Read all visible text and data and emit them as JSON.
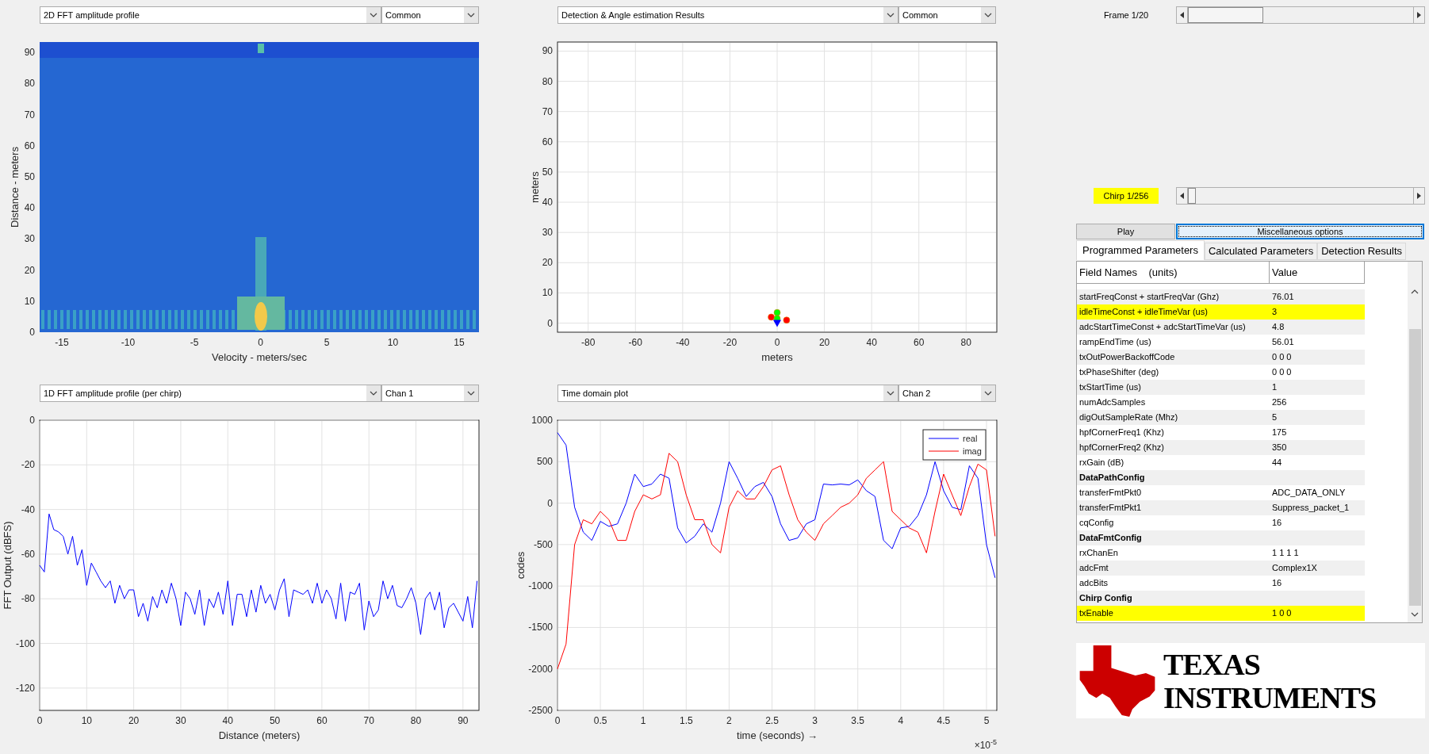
{
  "plots": [
    {
      "kind": "heatmap",
      "selector": "2D FFT amplitude profile",
      "option": "Common",
      "xticks": [
        "-15",
        "-10",
        "-5",
        "0",
        "5",
        "10",
        "15"
      ],
      "yticks": [
        "90",
        "80",
        "70",
        "60",
        "50",
        "40",
        "30",
        "20",
        "10",
        "0"
      ],
      "xlabel": "Velocity - meters/sec",
      "ylabel": "Distance - meters"
    },
    {
      "kind": "chart",
      "selector": "Detection & Angle estimation Results",
      "option": "Common",
      "chart_data": {
        "type": "scatter",
        "xlabel": "meters",
        "ylabel": "meters",
        "x": [
          -2.5,
          0,
          0,
          4,
          0
        ],
        "series": [
          {
            "color": "#ff0000",
            "marker": "circle",
            "values": [
              2,
              null,
              null,
              1,
              null
            ]
          },
          {
            "color": "#00ff00",
            "marker": "circle",
            "values": [
              null,
              3.5,
              1.5,
              null,
              null
            ]
          },
          {
            "color": "#0000ff",
            "marker": "triangle",
            "values": [
              null,
              null,
              null,
              null,
              0
            ]
          }
        ],
        "xlim": [
          -93,
          93
        ],
        "ylim": [
          -3,
          93
        ],
        "grid": true,
        "xticks": [
          -80,
          -60,
          -40,
          -20,
          0,
          20,
          40,
          60,
          80
        ],
        "yticks": [
          0,
          10,
          20,
          30,
          40,
          50,
          60,
          70,
          80,
          90
        ]
      }
    },
    {
      "kind": "chart",
      "selector": "1D FFT amplitude profile (per chirp)",
      "option": "Chan 1",
      "chart_data": {
        "type": "line",
        "xlabel": "Distance (meters)",
        "ylabel": "FFT Output (dBFS)",
        "x": [
          0,
          1,
          2,
          3,
          4,
          5,
          6,
          7,
          8,
          9,
          10,
          11,
          12,
          13,
          14,
          15,
          16,
          17,
          18,
          19,
          20,
          21,
          22,
          23,
          24,
          25,
          26,
          27,
          28,
          29,
          30,
          31,
          32,
          33,
          34,
          35,
          36,
          37,
          38,
          39,
          40,
          41,
          42,
          43,
          44,
          45,
          46,
          47,
          48,
          49,
          50,
          51,
          52,
          53,
          54,
          55,
          56,
          57,
          58,
          59,
          60,
          61,
          62,
          63,
          64,
          65,
          66,
          67,
          68,
          69,
          70,
          71,
          72,
          73,
          74,
          75,
          76,
          77,
          78,
          79,
          80,
          81,
          82,
          83,
          84,
          85,
          86,
          87,
          88,
          89,
          90,
          91,
          92,
          93
        ],
        "series": [
          {
            "color": "#0000ff",
            "values": [
              -65,
              -68,
              -42,
              -49,
              -50,
              -52,
              -60,
              -52,
              -65,
              -58,
              -74,
              -64,
              -68,
              -72,
              -75,
              -72,
              -82,
              -74,
              -80,
              -76,
              -76,
              -88,
              -82,
              -90,
              -79,
              -84,
              -76,
              -82,
              -73,
              -80,
              -92,
              -77,
              -80,
              -87,
              -76,
              -92,
              -80,
              -84,
              -77,
              -87,
              -72,
              -92,
              -78,
              -78,
              -88,
              -76,
              -86,
              -74,
              -82,
              -78,
              -85,
              -76,
              -71,
              -88,
              -76,
              -77,
              -78,
              -76,
              -82,
              -73,
              -82,
              -76,
              -80,
              -89,
              -73,
              -90,
              -77,
              -78,
              -73,
              -94,
              -81,
              -88,
              -85,
              -72,
              -80,
              -74,
              -83,
              -84,
              -80,
              -75,
              -82,
              -96,
              -80,
              -77,
              -85,
              -77,
              -93,
              -84,
              -82,
              -86,
              -90,
              -79,
              -93,
              -72
            ]
          }
        ],
        "xlim": [
          0,
          93.4
        ],
        "ylim": [
          -130,
          0
        ],
        "grid": true,
        "xticks": [
          0,
          10,
          20,
          30,
          40,
          50,
          60,
          70,
          80,
          90
        ],
        "yticks": [
          -120,
          -100,
          -80,
          -60,
          -40,
          -20,
          0
        ]
      }
    },
    {
      "kind": "chart",
      "selector": "Time domain plot",
      "option": "Chan 2",
      "axis_multiplier": {
        "base": "×10",
        "exponent": "-5"
      },
      "chart_data": {
        "type": "line",
        "xlabel": "time  (seconds) →",
        "ylabel": "codes",
        "x": [
          0,
          0.1,
          0.2,
          0.3,
          0.4,
          0.5,
          0.6,
          0.7,
          0.8,
          0.9,
          1,
          1.1,
          1.2,
          1.3,
          1.4,
          1.5,
          1.6,
          1.7,
          1.8,
          1.9,
          2,
          2.1,
          2.2,
          2.3,
          2.4,
          2.5,
          2.6,
          2.7,
          2.8,
          2.9,
          3,
          3.1,
          3.2,
          3.3,
          3.4,
          3.5,
          3.6,
          3.7,
          3.8,
          3.9,
          4,
          4.1,
          4.2,
          4.3,
          4.4,
          4.5,
          4.6,
          4.7,
          4.8,
          4.9,
          5,
          5.1
        ],
        "series": [
          {
            "name": "real",
            "color": "#0000ff",
            "values": [
              850,
              700,
              -50,
              -350,
              -450,
              -220,
              -280,
              -250,
              0,
              350,
              200,
              230,
              350,
              300,
              -300,
              -480,
              -400,
              -250,
              -350,
              0,
              500,
              300,
              80,
              200,
              250,
              80,
              -250,
              -450,
              -420,
              -250,
              -200,
              230,
              220,
              230,
              220,
              280,
              150,
              80,
              -450,
              -550,
              -300,
              -280,
              -150,
              100,
              500,
              150,
              -50,
              -80,
              450,
              300,
              -500,
              -900
            ]
          },
          {
            "name": "imag",
            "color": "#ff0000",
            "values": [
              -2000,
              -1700,
              -500,
              -200,
              -250,
              -100,
              -200,
              -450,
              -450,
              -100,
              100,
              50,
              100,
              600,
              500,
              100,
              -200,
              -200,
              -500,
              -600,
              -50,
              150,
              50,
              50,
              200,
              400,
              450,
              100,
              -200,
              -350,
              -450,
              -250,
              -150,
              -50,
              0,
              100,
              300,
              400,
              500,
              -100,
              -200,
              -300,
              -350,
              -600,
              -100,
              350,
              100,
              -150,
              200,
              470,
              400,
              -400
            ]
          }
        ],
        "xlim": [
          0,
          5.12
        ],
        "ylim": [
          -2500,
          1000
        ],
        "grid": true,
        "legend": true,
        "xticks": [
          0,
          0.5,
          1,
          1.5,
          2,
          2.5,
          3,
          3.5,
          4,
          4.5,
          5
        ],
        "yticks": [
          -2500,
          -2000,
          -1500,
          -1000,
          -500,
          0,
          500,
          1000
        ]
      }
    }
  ],
  "sliders": [
    {
      "label": "Frame 1/20",
      "highlighted": false,
      "level": 0
    },
    {
      "label": "Chirp 1/256",
      "highlighted": true,
      "level": 0
    }
  ],
  "buttons": [
    {
      "label": "Play",
      "focused": false
    },
    {
      "label": "Miscellaneous options",
      "focused": true
    }
  ],
  "tabs": [
    {
      "label": "Programmed Parameters",
      "selected": true
    },
    {
      "label": "Calculated Parameters",
      "selected": false
    },
    {
      "label": "Detection Results",
      "selected": false
    }
  ],
  "table": {
    "columns": [
      "Field Names    (units)",
      "Value"
    ],
    "rows": [
      {
        "kind": "field",
        "name": "startFreqConst + startFreqVar (Ghz)",
        "value": "76.01",
        "highlighted": false
      },
      {
        "kind": "field",
        "name": "idleTimeConst + idleTimeVar (us)",
        "value": "3",
        "highlighted": true
      },
      {
        "kind": "field",
        "name": "adcStartTimeConst + adcStartTimeVar (us)",
        "value": "4.8",
        "highlighted": false
      },
      {
        "kind": "field",
        "name": "rampEndTime (us)",
        "value": "56.01",
        "highlighted": false
      },
      {
        "kind": "field",
        "name": "txOutPowerBackoffCode",
        "value": "0 0 0",
        "highlighted": false
      },
      {
        "kind": "field",
        "name": "txPhaseShifter (deg)",
        "value": "0 0 0",
        "highlighted": false
      },
      {
        "kind": "field",
        "name": "txStartTime (us)",
        "value": "1",
        "highlighted": false
      },
      {
        "kind": "field",
        "name": "numAdcSamples",
        "value": "256",
        "highlighted": false
      },
      {
        "kind": "field",
        "name": "digOutSampleRate (Mhz)",
        "value": "5",
        "highlighted": false
      },
      {
        "kind": "field",
        "name": "hpfCornerFreq1 (Khz)",
        "value": "175",
        "highlighted": false
      },
      {
        "kind": "field",
        "name": "hpfCornerFreq2 (Khz)",
        "value": "350",
        "highlighted": false
      },
      {
        "kind": "field",
        "name": "rxGain (dB)",
        "value": "44",
        "highlighted": false
      },
      {
        "kind": "section",
        "name": "DataPathConfig",
        "highlighted": false
      },
      {
        "kind": "field",
        "name": "transferFmtPkt0",
        "value": "ADC_DATA_ONLY",
        "highlighted": false
      },
      {
        "kind": "field",
        "name": "transferFmtPkt1",
        "value": "Suppress_packet_1",
        "highlighted": false
      },
      {
        "kind": "field",
        "name": "cqConfig",
        "value": "16",
        "highlighted": false
      },
      {
        "kind": "section",
        "name": "DataFmtConfig",
        "highlighted": false
      },
      {
        "kind": "field",
        "name": "rxChanEn",
        "value": "1 1 1 1",
        "highlighted": false
      },
      {
        "kind": "field",
        "name": "adcFmt",
        "value": "Complex1X",
        "highlighted": false
      },
      {
        "kind": "field",
        "name": "adcBits",
        "value": "16",
        "highlighted": false
      },
      {
        "kind": "section",
        "name": "Chirp Config",
        "highlighted": false
      },
      {
        "kind": "field",
        "name": "txEnable",
        "value": "1 0 0",
        "highlighted": true
      }
    ]
  },
  "logo": {
    "lines": [
      "TEXAS",
      "INSTRUMENTS"
    ]
  }
}
